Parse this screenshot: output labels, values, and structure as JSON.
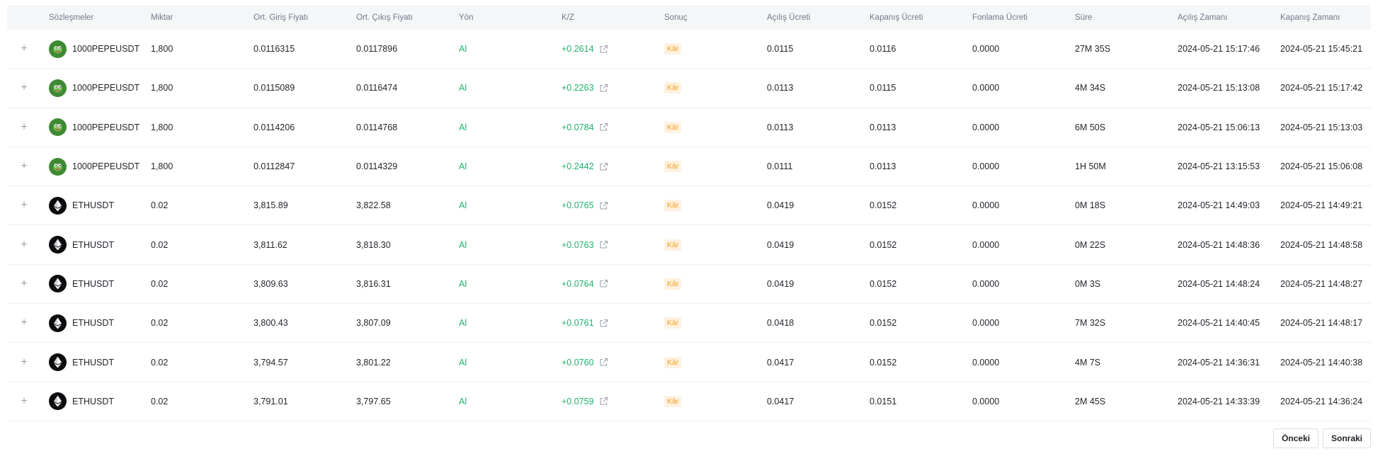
{
  "columns": {
    "contract": "Sözleşmeler",
    "qty": "Miktar",
    "entry": "Ort. Giriş Fiyatı",
    "exit": "Ort. Çıkış Fiyatı",
    "dir": "Yön",
    "pnl": "K/Z",
    "result": "Sonuç",
    "openfee": "Açılış Ücreti",
    "closefee": "Kapanış Ücreti",
    "funding": "Fonlama Ücreti",
    "dur": "Süre",
    "opentime": "Açılış Zamanı",
    "closetime": "Kapanış Zamanı"
  },
  "expand_glyph": "+",
  "colors": {
    "profit_green": "#20b26c",
    "badge_bg": "#fff1e0",
    "badge_text": "#f0a020",
    "header_bg": "#f5f6f8"
  },
  "rows": [
    {
      "icon": "pepe-coin-icon",
      "symbol": "1000PEPEUSDT",
      "qty": "1,800",
      "entry": "0.0116315",
      "exit": "0.0117896",
      "dir": "Al",
      "pnl": "+0.2614",
      "result": "Kâr",
      "openfee": "0.0115",
      "closefee": "0.0116",
      "funding": "0.0000",
      "dur": "27M 35S",
      "opentime": "2024-05-21 15:17:46",
      "closetime": "2024-05-21 15:45:21"
    },
    {
      "icon": "pepe-coin-icon",
      "symbol": "1000PEPEUSDT",
      "qty": "1,800",
      "entry": "0.0115089",
      "exit": "0.0116474",
      "dir": "Al",
      "pnl": "+0.2263",
      "result": "Kâr",
      "openfee": "0.0113",
      "closefee": "0.0115",
      "funding": "0.0000",
      "dur": "4M 34S",
      "opentime": "2024-05-21 15:13:08",
      "closetime": "2024-05-21 15:17:42"
    },
    {
      "icon": "pepe-coin-icon",
      "symbol": "1000PEPEUSDT",
      "qty": "1,800",
      "entry": "0.0114206",
      "exit": "0.0114768",
      "dir": "Al",
      "pnl": "+0.0784",
      "result": "Kâr",
      "openfee": "0.0113",
      "closefee": "0.0113",
      "funding": "0.0000",
      "dur": "6M 50S",
      "opentime": "2024-05-21 15:06:13",
      "closetime": "2024-05-21 15:13:03"
    },
    {
      "icon": "pepe-coin-icon",
      "symbol": "1000PEPEUSDT",
      "qty": "1,800",
      "entry": "0.0112847",
      "exit": "0.0114329",
      "dir": "Al",
      "pnl": "+0.2442",
      "result": "Kâr",
      "openfee": "0.0111",
      "closefee": "0.0113",
      "funding": "0.0000",
      "dur": "1H 50M",
      "opentime": "2024-05-21 13:15:53",
      "closetime": "2024-05-21 15:06:08"
    },
    {
      "icon": "eth-coin-icon",
      "symbol": "ETHUSDT",
      "qty": "0.02",
      "entry": "3,815.89",
      "exit": "3,822.58",
      "dir": "Al",
      "pnl": "+0.0765",
      "result": "Kâr",
      "openfee": "0.0419",
      "closefee": "0.0152",
      "funding": "0.0000",
      "dur": "0M 18S",
      "opentime": "2024-05-21 14:49:03",
      "closetime": "2024-05-21 14:49:21"
    },
    {
      "icon": "eth-coin-icon",
      "symbol": "ETHUSDT",
      "qty": "0.02",
      "entry": "3,811.62",
      "exit": "3,818.30",
      "dir": "Al",
      "pnl": "+0.0763",
      "result": "Kâr",
      "openfee": "0.0419",
      "closefee": "0.0152",
      "funding": "0.0000",
      "dur": "0M 22S",
      "opentime": "2024-05-21 14:48:36",
      "closetime": "2024-05-21 14:48:58"
    },
    {
      "icon": "eth-coin-icon",
      "symbol": "ETHUSDT",
      "qty": "0.02",
      "entry": "3,809.63",
      "exit": "3,816.31",
      "dir": "Al",
      "pnl": "+0.0764",
      "result": "Kâr",
      "openfee": "0.0419",
      "closefee": "0.0152",
      "funding": "0.0000",
      "dur": "0M 3S",
      "opentime": "2024-05-21 14:48:24",
      "closetime": "2024-05-21 14:48:27"
    },
    {
      "icon": "eth-coin-icon",
      "symbol": "ETHUSDT",
      "qty": "0.02",
      "entry": "3,800.43",
      "exit": "3,807.09",
      "dir": "Al",
      "pnl": "+0.0761",
      "result": "Kâr",
      "openfee": "0.0418",
      "closefee": "0.0152",
      "funding": "0.0000",
      "dur": "7M 32S",
      "opentime": "2024-05-21 14:40:45",
      "closetime": "2024-05-21 14:48:17"
    },
    {
      "icon": "eth-coin-icon",
      "symbol": "ETHUSDT",
      "qty": "0.02",
      "entry": "3,794.57",
      "exit": "3,801.22",
      "dir": "Al",
      "pnl": "+0.0760",
      "result": "Kâr",
      "openfee": "0.0417",
      "closefee": "0.0152",
      "funding": "0.0000",
      "dur": "4M 7S",
      "opentime": "2024-05-21 14:36:31",
      "closetime": "2024-05-21 14:40:38"
    },
    {
      "icon": "eth-coin-icon",
      "symbol": "ETHUSDT",
      "qty": "0.02",
      "entry": "3,791.01",
      "exit": "3,797.65",
      "dir": "Al",
      "pnl": "+0.0759",
      "result": "Kâr",
      "openfee": "0.0417",
      "closefee": "0.0151",
      "funding": "0.0000",
      "dur": "2M 45S",
      "opentime": "2024-05-21 14:33:39",
      "closetime": "2024-05-21 14:36:24"
    }
  ],
  "pagination": {
    "prev": "Önceki",
    "next": "Sonraki"
  }
}
